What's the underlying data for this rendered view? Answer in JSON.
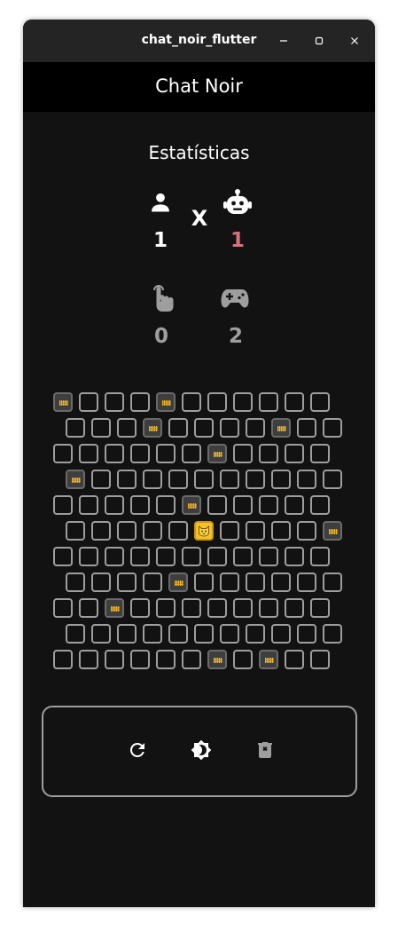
{
  "window": {
    "title": "chat_noir_flutter"
  },
  "appbar": {
    "title": "Chat Noir"
  },
  "stats": {
    "title": "Estatísticas",
    "player_wins": "1",
    "versus": "X",
    "cpu_wins": "1",
    "moves": "0",
    "games": "2"
  },
  "icons": {
    "player": "person-icon",
    "cpu": "robot-icon",
    "moves": "touch-icon",
    "games": "gamepad-icon",
    "restart": "refresh-icon",
    "theme": "brightness-icon",
    "clear": "delete-icon"
  },
  "colors": {
    "background": "#121212",
    "appbar": "#000000",
    "cell_border": "#9e9e9e",
    "blocked_cell": "#3e3e3e",
    "fence": "#f0b429",
    "cat": "#f2c22a",
    "cpu_score": "#d9707e",
    "muted": "#9e9e9e"
  },
  "board": {
    "rows": 11,
    "cols": 11,
    "blocked": [
      [
        0,
        0
      ],
      [
        0,
        4
      ],
      [
        1,
        3
      ],
      [
        1,
        8
      ],
      [
        2,
        6
      ],
      [
        3,
        0
      ],
      [
        4,
        5
      ],
      [
        5,
        10
      ],
      [
        7,
        4
      ],
      [
        8,
        2
      ],
      [
        10,
        6
      ],
      [
        10,
        8
      ]
    ],
    "cat": [
      5,
      5
    ]
  }
}
